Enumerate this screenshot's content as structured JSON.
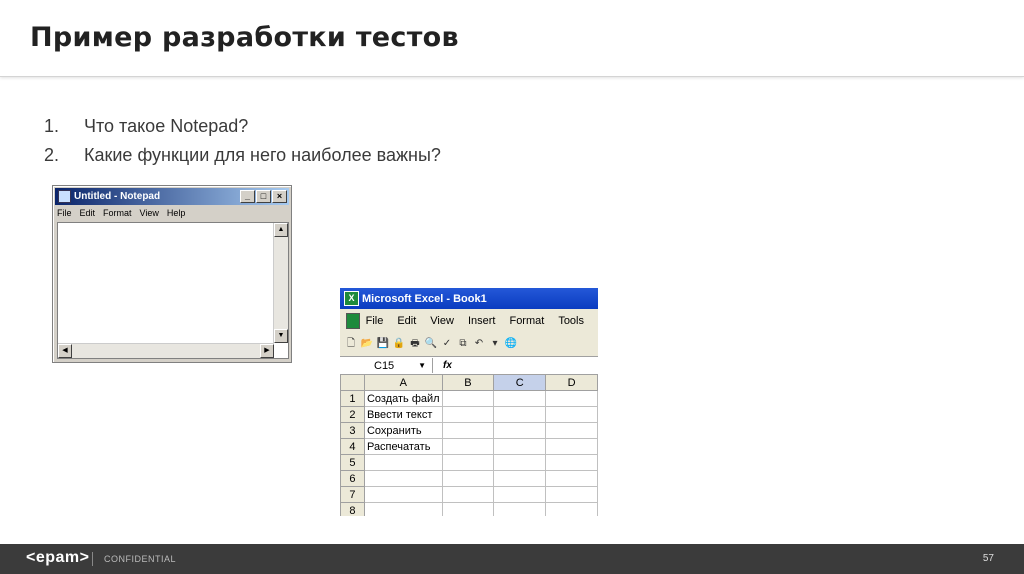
{
  "slide": {
    "title": "Пример разработки тестов",
    "list": [
      {
        "num": "1.",
        "text": "Что такое Notepad?"
      },
      {
        "num": "2.",
        "text": "Какие функции для него наиболее важны?"
      }
    ]
  },
  "notepad": {
    "title": "Untitled - Notepad",
    "controls": [
      "_",
      "□",
      "×"
    ],
    "menu": [
      "File",
      "Edit",
      "Format",
      "View",
      "Help"
    ]
  },
  "excel": {
    "title": "Microsoft Excel - Book1",
    "menu": [
      "File",
      "Edit",
      "View",
      "Insert",
      "Format",
      "Tools"
    ],
    "name_box": "C15",
    "fx_label": "fx",
    "columns": [
      "A",
      "B",
      "C",
      "D"
    ],
    "selected_column": "C",
    "rows": [
      {
        "num": "1",
        "a": "Создать файл"
      },
      {
        "num": "2",
        "a": "Ввести текст"
      },
      {
        "num": "3",
        "a": "Сохранить"
      },
      {
        "num": "4",
        "a": "Распечатать"
      },
      {
        "num": "5",
        "a": ""
      },
      {
        "num": "6",
        "a": ""
      },
      {
        "num": "7",
        "a": ""
      },
      {
        "num": "8",
        "a": ""
      }
    ]
  },
  "footer": {
    "logo": "<epam>",
    "label": "CONFIDENTIAL",
    "page": "57"
  }
}
